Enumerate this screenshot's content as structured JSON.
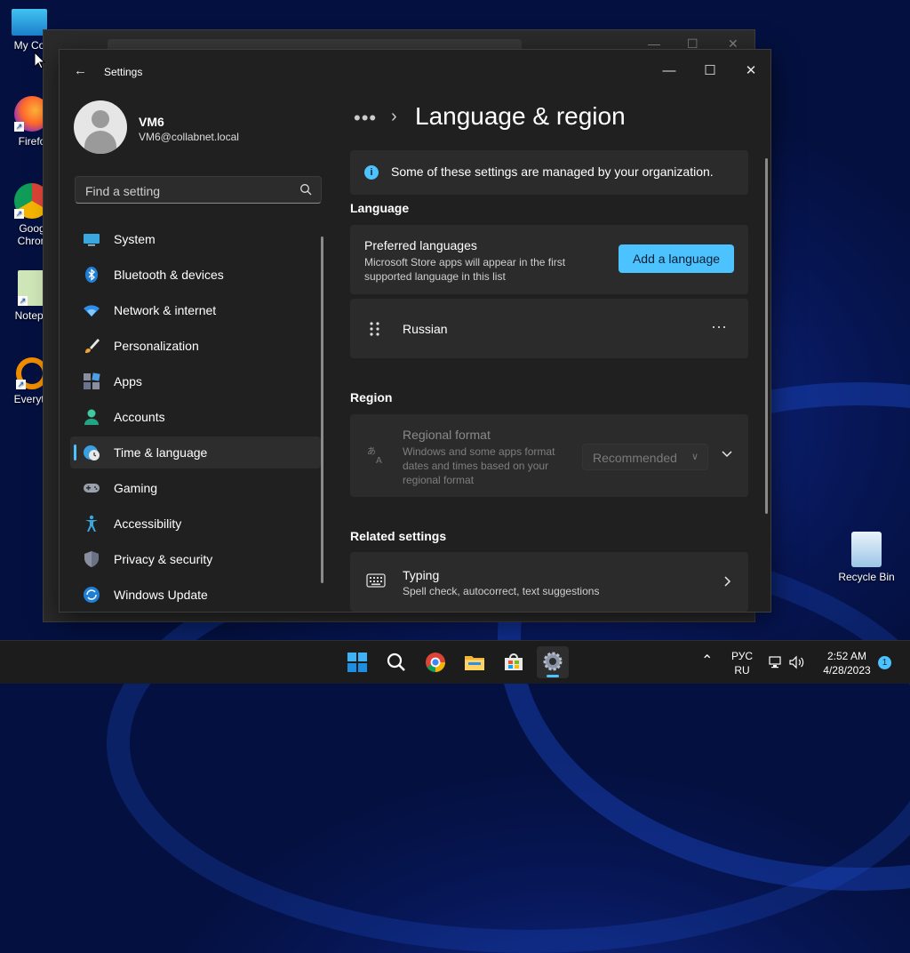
{
  "desktop": {
    "icons": [
      {
        "label": "My Co"
      },
      {
        "label": "Firefo"
      },
      {
        "label": "Goog Chron"
      },
      {
        "label": "Notepa"
      },
      {
        "label": "Everyth"
      },
      {
        "label": "Recycle Bin"
      }
    ]
  },
  "window": {
    "title": "Settings",
    "controls": {
      "minimize": "—",
      "maximize": "☐",
      "close": "✕"
    }
  },
  "profile": {
    "name": "VM6",
    "email": "VM6@collabnet.local"
  },
  "search": {
    "placeholder": "Find a setting"
  },
  "nav": {
    "items": [
      {
        "label": "System"
      },
      {
        "label": "Bluetooth & devices"
      },
      {
        "label": "Network & internet"
      },
      {
        "label": "Personalization"
      },
      {
        "label": "Apps"
      },
      {
        "label": "Accounts"
      },
      {
        "label": "Time & language"
      },
      {
        "label": "Gaming"
      },
      {
        "label": "Accessibility"
      },
      {
        "label": "Privacy & security"
      },
      {
        "label": "Windows Update"
      }
    ],
    "selected": "Time & language"
  },
  "content": {
    "breadcrumb_more": "•••",
    "breadcrumb_sep": "›",
    "title": "Language & region",
    "managed_notice": "Some of these settings are managed by your organization.",
    "language_section": "Language",
    "preferred": {
      "title": "Preferred languages",
      "description": "Microsoft Store apps will appear in the first supported language in this list",
      "button": "Add a language"
    },
    "languages": [
      {
        "name": "Russian"
      }
    ],
    "region_section": "Region",
    "regional_format": {
      "title": "Regional format",
      "description": "Windows and some apps format dates and times based on your regional format",
      "value": "Recommended"
    },
    "related_section": "Related settings",
    "typing": {
      "title": "Typing",
      "description": "Spell check, autocorrect, text suggestions"
    }
  },
  "taskbar": {
    "lang_top": "РУС",
    "lang_bottom": "RU",
    "time": "2:52 AM",
    "date": "4/28/2023",
    "notification_count": "1"
  },
  "colors": {
    "accent": "#4cc2ff",
    "window_bg": "#202020",
    "card_bg": "#2b2b2b"
  }
}
